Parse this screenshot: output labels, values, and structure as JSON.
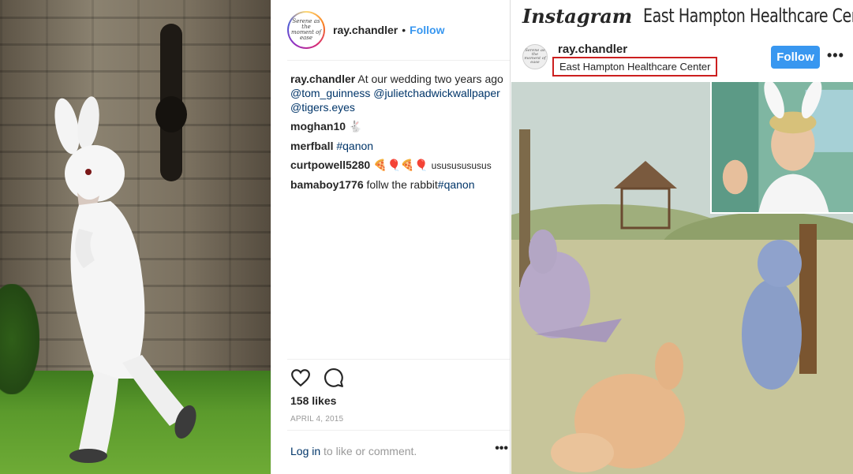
{
  "post": {
    "username": "ray.chandler",
    "dot": "•",
    "follow_label": "Follow",
    "avatar_text": "Serene as the moment of ease",
    "comments": [
      {
        "user": "ray.chandler",
        "text": "At our wedding two years ago",
        "mentions": [
          "@tom_guinness",
          "@julietchadwickwallpaper",
          "@tigers.eyes"
        ]
      },
      {
        "user": "moghan10",
        "emoji": "🐇"
      },
      {
        "user": "merfball",
        "hashtag": "#qanon"
      },
      {
        "user": "curtpowell5280",
        "emoji": "🍕🎈🍕🎈",
        "text": "usususususus"
      },
      {
        "user": "bamaboy1776",
        "text": "follw the rabbit",
        "hashtag": "#qanon"
      }
    ],
    "likes": "158 likes",
    "date": "APRIL 4, 2015",
    "login_link": "Log in",
    "login_text": "to like or comment.",
    "more": "•••",
    "icons": [
      "heart-icon",
      "comment-icon"
    ]
  },
  "right": {
    "logo": "Instagram",
    "heading": "East Hampton Healthcare Center",
    "username": "ray.chandler",
    "location": "East Hampton Healthcare Center",
    "follow_label": "Follow",
    "more": "•••",
    "highlight_color": "#cc1f1f"
  },
  "colors": {
    "accent": "#3897f0",
    "link": "#003569",
    "muted": "#999999"
  }
}
